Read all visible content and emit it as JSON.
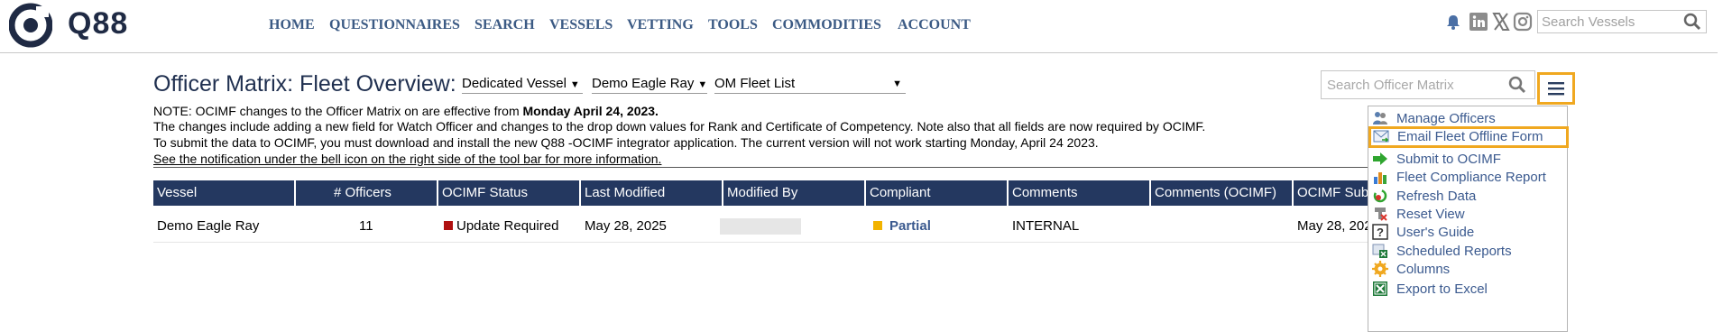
{
  "brand": {
    "name": "Q88"
  },
  "nav": {
    "items": [
      "HOME",
      "QUESTIONNAIRES",
      "SEARCH",
      "VESSELS",
      "VETTING",
      "TOOLS",
      "COMMODITIES",
      "ACCOUNT"
    ],
    "search_placeholder": "Search Vessels",
    "icons": [
      "bell-icon",
      "linkedin-icon",
      "x-icon",
      "instagram-icon",
      "search-icon"
    ]
  },
  "page": {
    "title": "Officer Matrix: Fleet Overview:",
    "filters": {
      "vessel_type": "Dedicated Vessel",
      "vessel": "Demo Eagle Ray",
      "fleet_list": "OM Fleet List"
    },
    "search_placeholder": "Search Officer Matrix"
  },
  "notice": {
    "line1_prefix": "NOTE: OCIMF changes to the Officer Matrix on are effective from ",
    "line1_bold": "Monday April 24, 2023.",
    "line2": "The changes include adding a new field for Watch Officer and changes to the drop down values for Rank and Certificate of Competency. Note also that all fields are now required by OCIMF.",
    "line3": "To submit the data to OCIMF, you must download and install the new Q88 -OCIMF integrator application. The current version will not work starting Monday, April 24 2023.",
    "line4": "See the notification under the bell icon on the right side of the tool bar for more information."
  },
  "table": {
    "columns": [
      "Vessel",
      "# Officers",
      "OCIMF Status",
      "Last Modified",
      "Modified By",
      "Compliant",
      "Comments",
      "Comments (OCIMF)",
      "OCIMF Submitted"
    ],
    "rows": [
      {
        "vessel": "Demo Eagle Ray",
        "officers": "11",
        "ocimf_status": "Update Required",
        "last_modified": "May 28, 2025",
        "modified_by": "",
        "compliant": "Partial",
        "comments": "INTERNAL",
        "comments_ocimf": "",
        "ocimf_submitted": "May 28, 2025"
      }
    ],
    "status_colors": {
      "update_required": "#b01010",
      "partial": "#f2b300"
    }
  },
  "menu": {
    "items": [
      {
        "label": "Manage Officers",
        "icon": "users-icon"
      },
      {
        "label": "Email Fleet Offline Form",
        "icon": "email-icon",
        "highlighted": true
      },
      {
        "label": "Submit to OCIMF",
        "icon": "arrow-right-icon"
      },
      {
        "label": "Fleet Compliance Report",
        "icon": "bar-chart-icon"
      },
      {
        "label": "Refresh Data",
        "icon": "refresh-icon"
      },
      {
        "label": "Reset View",
        "icon": "reset-icon"
      },
      {
        "label": "User's Guide",
        "icon": "help-icon"
      },
      {
        "label": "Scheduled Reports",
        "icon": "scheduled-report-icon"
      },
      {
        "label": "Columns",
        "icon": "gear-icon"
      },
      {
        "label": "Export to Excel",
        "icon": "excel-icon"
      }
    ]
  },
  "colors": {
    "accent": "#f0a820",
    "header_bg": "#243860",
    "nav_text": "#3b5a84",
    "link": "#3b5a8f"
  }
}
